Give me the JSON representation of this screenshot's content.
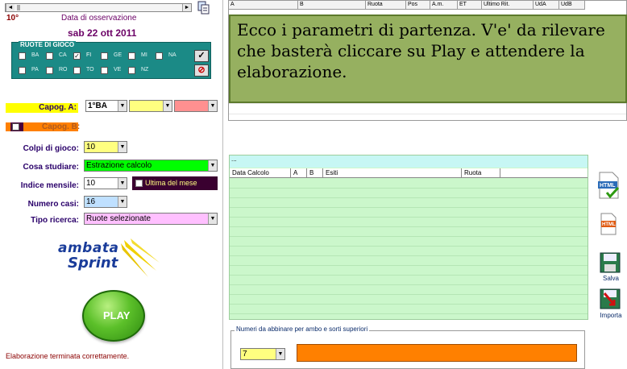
{
  "header": {
    "number": "10°",
    "obs_label": "Data di osservazione",
    "obs_date": "sab 22 ott 2011"
  },
  "ruote": {
    "title": "RUOTE DI GIOCO",
    "items": [
      {
        "label": "BA",
        "checked": false
      },
      {
        "label": "CA",
        "checked": false
      },
      {
        "label": "FI",
        "checked": true
      },
      {
        "label": "GE",
        "checked": false
      },
      {
        "label": "MI",
        "checked": false
      },
      {
        "label": "NA",
        "checked": false
      },
      {
        "label": "PA",
        "checked": false
      },
      {
        "label": "RO",
        "checked": false
      },
      {
        "label": "TO",
        "checked": false
      },
      {
        "label": "VE",
        "checked": false
      },
      {
        "label": "NZ",
        "checked": false
      }
    ],
    "select_all_icon": "check-icon",
    "clear_icon": "no-entry-icon"
  },
  "capog_a": {
    "label": "Capog. A:",
    "value": "1°BA",
    "value2": "",
    "value3": ""
  },
  "capog_b": {
    "label": "Capog. B:"
  },
  "form": {
    "colpi_label": "Colpi di gioco:",
    "colpi_value": "10",
    "studiare_label": "Cosa studiare:",
    "studiare_value": "Estrazione calcolo",
    "indice_label": "Indice mensile:",
    "indice_value": "10",
    "ultima_label": "Ultima del mese",
    "casi_label": "Numero casi:",
    "casi_value": "16",
    "tipo_label": "Tipo ricerca:",
    "tipo_value": "Ruote selezionate"
  },
  "logo": {
    "line1": "ambata",
    "line2": "Sprint"
  },
  "play_label": "PLAY",
  "status": "Elaborazione terminata correttamente.",
  "top_grid_headers": [
    "A",
    "B",
    "Ruota",
    "Pos",
    "A.m.",
    "ET",
    "Ultimo Rit.",
    "UdA",
    "UdB"
  ],
  "note_text": "Ecco i parametri di partenza. V'e' da rilevare che basterà cliccare su Play e attendere la elaborazione.",
  "results": {
    "top_text": "...",
    "headers": [
      "Data Calcolo",
      "A",
      "B",
      "Esiti",
      "Ruota"
    ]
  },
  "abbinare": {
    "legend": "Numeri da abbinare per ambo e sorti superiori",
    "value": "7"
  },
  "side_icons": [
    {
      "name": "html-check-icon",
      "caption": ""
    },
    {
      "name": "html-file-icon",
      "caption": ""
    },
    {
      "name": "floppy-save-icon",
      "caption": "Salva"
    },
    {
      "name": "import-icon",
      "caption": "Importa"
    }
  ],
  "colors": {
    "capog_a_bg": "#ffff00",
    "capog_b_bg": "#ff8000",
    "note_bg": "#96b060",
    "results_bg": "#cbf7cb",
    "studiare_bg": "#00ff00",
    "tipo_bg": "#ffc0ff",
    "abbinare_bg": "#ff8000"
  }
}
